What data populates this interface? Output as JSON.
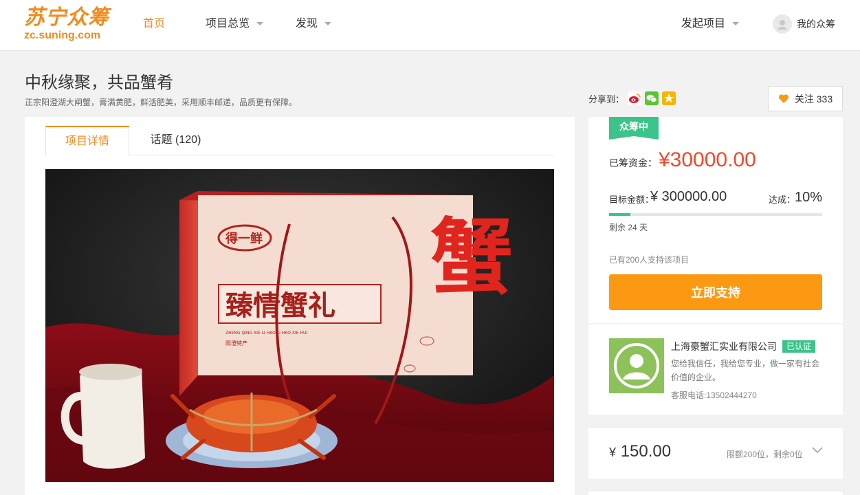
{
  "header": {
    "logo_cn": "苏宁众筹",
    "logo_en": "zc.suning.com",
    "nav": [
      {
        "label": "首页",
        "active": true,
        "dropdown": false
      },
      {
        "label": "项目总览",
        "active": false,
        "dropdown": true
      },
      {
        "label": "发现",
        "active": false,
        "dropdown": true
      }
    ],
    "launch": "发起项目",
    "my": "我的众筹"
  },
  "project": {
    "title": "中秋缘聚，共品蟹肴",
    "subtitle": "正宗阳澄湖大闸蟹，膏满黄肥，鲜活肥美，采用顺丰邮递，品质更有保障。",
    "share_label": "分享到：",
    "share_icons": [
      "weibo-icon",
      "wechat-icon",
      "qzone-icon"
    ],
    "follow_label": "关注 333"
  },
  "tabs": [
    {
      "label": "项目详情",
      "active": true
    },
    {
      "label": "话题 (120)",
      "active": false
    }
  ],
  "hero": {
    "box_title": "臻情蟹礼",
    "box_subtitle": "得一鲜",
    "box_pinyin": "ZHENG QING XIE LI HAO LI HAO XIE HUI",
    "box_tag": "阳澄特产",
    "big_char": "蟹"
  },
  "funding": {
    "status": "众筹中",
    "raised_label": "已筹资金：",
    "raised_value": "¥30000.00",
    "goal_label": "目标金额：",
    "goal_value": "¥ 300000.00",
    "reach_label": "达成：",
    "reach_value": "10%",
    "progress": 0.1,
    "remain": "剩余 24 天",
    "supporters": "已有200人支持该项目",
    "support_btn": "立即支持"
  },
  "company": {
    "name": "上海豪蟹汇实业有限公司",
    "verified": "已认证",
    "desc": "您给我信任，我给您专业，做一家有社会价值的企业。",
    "phone": "客服电话:13502444270"
  },
  "reward": {
    "price_symbol": "¥",
    "price": "150.00",
    "limit": "限额200位，剩余0位"
  },
  "colors": {
    "brand": "#f08c1e",
    "success": "#3cc38a",
    "highlight": "#f2482a",
    "button": "#fb9a12"
  }
}
